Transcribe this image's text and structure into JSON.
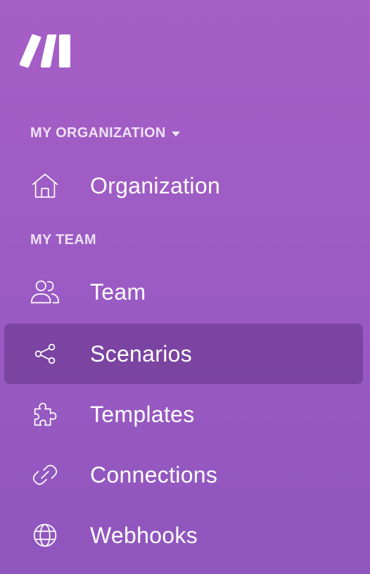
{
  "sidebar": {
    "brand_icon": "make-logo-icon",
    "colors": {
      "background_top": "#a65fc6",
      "background_bottom": "#8f56bd",
      "active_item": "#7a4a9c",
      "text": "#ffffff"
    },
    "sections": {
      "organization": {
        "header": "MY ORGANIZATION",
        "items": [
          {
            "label": "Organization",
            "icon": "home-icon"
          }
        ]
      },
      "team": {
        "header": "MY TEAM",
        "items": [
          {
            "label": "Team",
            "icon": "users-icon"
          },
          {
            "label": "Scenarios",
            "icon": "share-nodes-icon",
            "active": true
          },
          {
            "label": "Templates",
            "icon": "puzzle-icon"
          },
          {
            "label": "Connections",
            "icon": "link-icon"
          },
          {
            "label": "Webhooks",
            "icon": "globe-icon"
          }
        ]
      }
    }
  }
}
